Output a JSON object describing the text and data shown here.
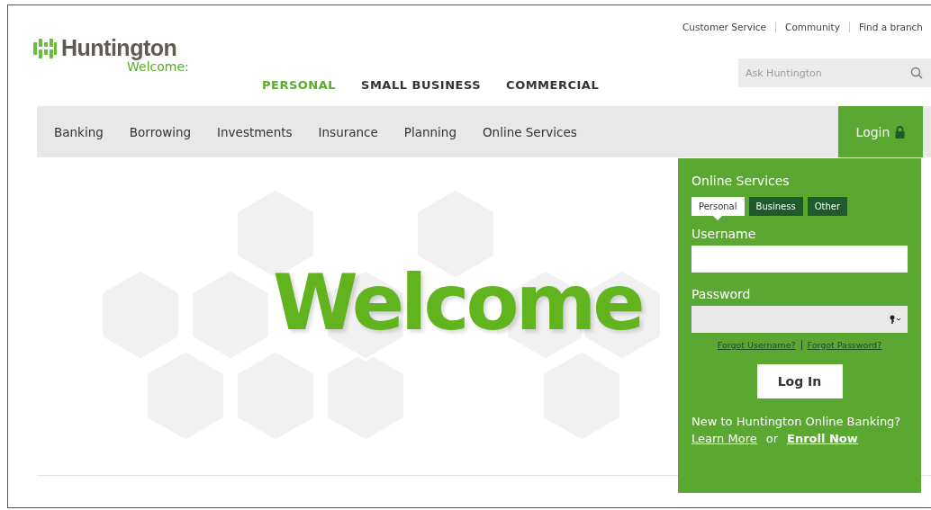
{
  "logo": {
    "name": "Huntington",
    "tagline": "Welcome:"
  },
  "utility_links": [
    "Customer Service",
    "Community",
    "Find a branch"
  ],
  "segments": [
    {
      "label": "PERSONAL",
      "selected": true
    },
    {
      "label": "SMALL BUSINESS",
      "selected": false
    },
    {
      "label": "COMMERCIAL",
      "selected": false
    }
  ],
  "search": {
    "placeholder": "Ask Huntington"
  },
  "nav": {
    "items": [
      "Banking",
      "Borrowing",
      "Investments",
      "Insurance",
      "Planning",
      "Online Services"
    ],
    "login_tab": "Login"
  },
  "login_panel": {
    "title": "Online Services",
    "tabs": [
      {
        "label": "Personal",
        "selected": true
      },
      {
        "label": "Business",
        "selected": false
      },
      {
        "label": "Other",
        "selected": false
      }
    ],
    "username_label": "Username",
    "password_label": "Password",
    "forgot_links": [
      "Forgot Username?",
      "Forgot Password?"
    ],
    "button": "Log In",
    "enroll_text": "New to Huntington Online Banking?",
    "learn_more": "Learn More",
    "or": "or",
    "enroll_now": "Enroll Now"
  },
  "hero": {
    "heading": "Welcome"
  }
}
